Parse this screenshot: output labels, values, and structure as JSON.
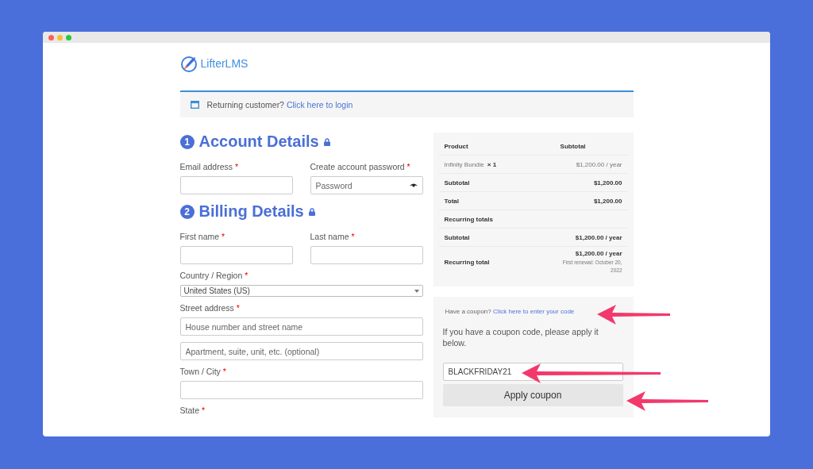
{
  "logo": {
    "text": "LifterLMS"
  },
  "notice": {
    "text": "Returning customer?",
    "link": "Click here to login"
  },
  "sections": [
    {
      "number": "1",
      "title": "Account Details",
      "rows": [
        [
          {
            "kind": "input",
            "label": "Email address",
            "mark": "*"
          },
          {
            "kind": "password",
            "label": "Create account password",
            "mark": "*",
            "placeholder": "Password"
          }
        ]
      ]
    },
    {
      "number": "2",
      "title": "Billing Details",
      "rows": [
        [
          {
            "kind": "input",
            "label": "First name",
            "mark": "*"
          },
          {
            "kind": "input",
            "label": "Last name",
            "mark": "*"
          }
        ],
        [
          {
            "kind": "select",
            "label": "Country / Region",
            "mark": "*",
            "value": "United States (US)"
          }
        ],
        [
          {
            "kind": "input",
            "label": "Street address",
            "mark": "*",
            "placeholder": "House number and street name"
          }
        ],
        [
          {
            "kind": "input",
            "placeholder": "Apartment, suite, unit, etc. (optional)"
          }
        ],
        [
          {
            "kind": "input",
            "label": "Town / City",
            "mark": "*"
          }
        ],
        [
          {
            "kind": "label",
            "label": "State",
            "mark": "*"
          }
        ]
      ]
    }
  ],
  "order_summary": {
    "columns": [
      "Product",
      "Subtotal"
    ],
    "rows": [
      {
        "kind": "item",
        "label": "Infinity Bundle",
        "qty": "× 1",
        "value": "$1,200.00 / year"
      },
      {
        "kind": "total",
        "label": "Subtotal",
        "value": "$1,200.00"
      },
      {
        "kind": "total",
        "label": "Total",
        "value": "$1,200.00"
      },
      {
        "kind": "heading",
        "label": "Recurring totals"
      },
      {
        "kind": "total",
        "label": "Subtotal",
        "value": "$1,200.00 / year"
      },
      {
        "kind": "recurring",
        "label": "Recurring total",
        "value": "$1,200.00 / year",
        "note": "First renewal: October 20, 2022"
      }
    ]
  },
  "coupon": {
    "prompt": "Have a coupon?",
    "link": "Click here to enter your code",
    "hint": "If you have a coupon code, please apply it below.",
    "value": "BLACKFRIDAY21",
    "button": "Apply coupon"
  }
}
